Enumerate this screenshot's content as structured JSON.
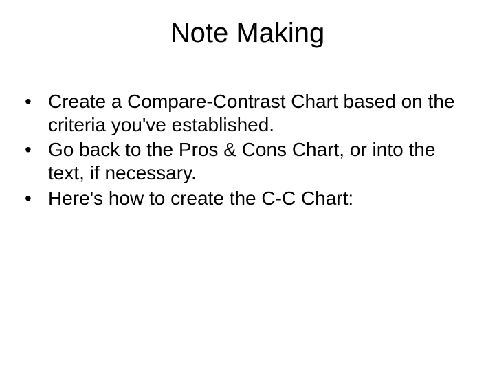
{
  "slide": {
    "title": "Note Making",
    "bullets": [
      "Create a Compare-Contrast Chart based on the criteria you've established.",
      "Go back to the Pros & Cons Chart, or into the text, if necessary.",
      "Here's how to create the C-C Chart:"
    ]
  }
}
